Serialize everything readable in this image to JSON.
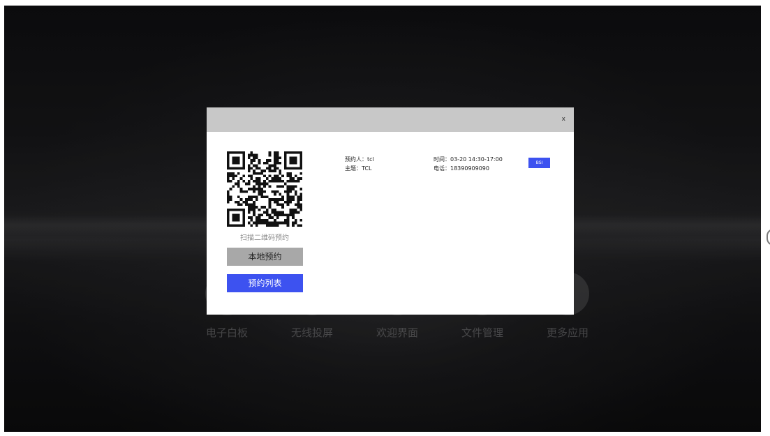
{
  "home": {
    "apps": [
      {
        "label": "电子白板",
        "icon": "whiteboard-icon"
      },
      {
        "label": "无线投屏",
        "icon": "screen-cast-icon"
      },
      {
        "label": "欢迎界面",
        "icon": "welcome-icon"
      },
      {
        "label": "文件管理",
        "icon": "folder-icon"
      },
      {
        "label": "更多应用",
        "icon": "more-apps-icon"
      }
    ]
  },
  "modal": {
    "close_label": "x",
    "qr_caption": "扫描二维码预约",
    "local_booking_label": "本地预约",
    "booking_list_label": "预约列表",
    "booking": {
      "booker": "预约人：tcl",
      "topic": "主题：TCL",
      "time": "时间：03-20 14:30-17:00",
      "phone": "电话：18390909090",
      "action_label": "BSI"
    }
  },
  "colors": {
    "accent": "#3d52f0",
    "header_gray": "#c8c8c8",
    "secondary_button": "#a8a8a8"
  }
}
